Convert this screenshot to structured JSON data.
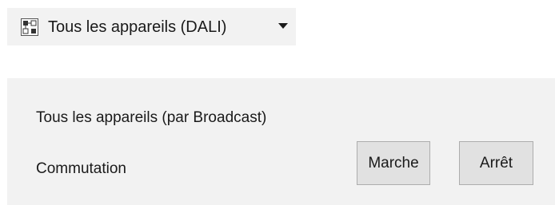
{
  "device_selector": {
    "icon": "dali-devices-icon",
    "label": "Tous les appareils (DALI)"
  },
  "panel": {
    "title": "Tous les appareils (par Broadcast)",
    "switching": {
      "label": "Commutation",
      "on_label": "Marche",
      "off_label": "Arrêt"
    }
  }
}
